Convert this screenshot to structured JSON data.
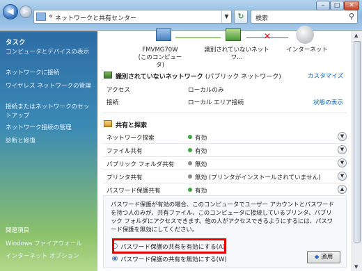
{
  "address": {
    "path": "ネットワークと共有センター"
  },
  "search": {
    "placeholder": "検索"
  },
  "sidebar": {
    "title": "タスク",
    "items": [
      {
        "label": "コンピュータとデバイスの表示"
      },
      {
        "label": "ネットワークに接続"
      },
      {
        "label": "ワイヤレス ネットワークの管理"
      },
      {
        "label": "接続またはネットワークのセットアップ"
      },
      {
        "label": "ネットワーク接続の管理"
      },
      {
        "label": "診断と修復"
      }
    ],
    "related_title": "関連項目",
    "related": [
      {
        "label": "Windows ファイアウォール"
      },
      {
        "label": "インターネット オプション"
      }
    ]
  },
  "map": {
    "computer_name": "FMVMG70W",
    "computer_sub": "(このコンピュータ)",
    "network_label": "識別されていないネットワ...",
    "internet_label": "インターネット"
  },
  "network": {
    "title": "識別されていないネットワーク",
    "type": "(パブリック ネットワーク)",
    "customize": "カスタマイズ",
    "access_label": "アクセス",
    "access_value": "ローカルのみ",
    "connection_label": "接続",
    "connection_value": "ローカル エリア接続",
    "status_link": "状態の表示"
  },
  "sharing": {
    "title": "共有と探索",
    "rows": [
      {
        "label": "ネットワーク探索",
        "value": "有効",
        "status_color": "#3aa83a"
      },
      {
        "label": "ファイル共有",
        "value": "有効",
        "status_color": "#3aa83a"
      },
      {
        "label": "パブリック フォルダ共有",
        "value": "無効",
        "status_color": "#8a8a8a"
      },
      {
        "label": "プリンタ共有",
        "value": "無効 (プリンタがインストールされていません)",
        "status_color": "#8a8a8a"
      },
      {
        "label": "パスワード保護共有",
        "value": "有効",
        "status_color": "#3aa83a"
      }
    ],
    "description": "パスワード保護が有効の場合、このコンピュータでユーザー アカウントとパスワードを持つ人のみが、共有ファイル、このコンピュータに接続しているプリンタ、パブリック フォルダにアクセスできます。他の人がアクセスできるようにするには、パスワード保護を無効にしてください。",
    "option_on": "パスワード保護の共有を有効にする(A)",
    "option_off": "パスワード保護の共有を無効にする(W)",
    "apply": "適用"
  },
  "icons": {
    "back": "back-arrow-icon",
    "forward": "forward-arrow-icon",
    "refresh": "refresh-icon",
    "search": "search-icon"
  }
}
